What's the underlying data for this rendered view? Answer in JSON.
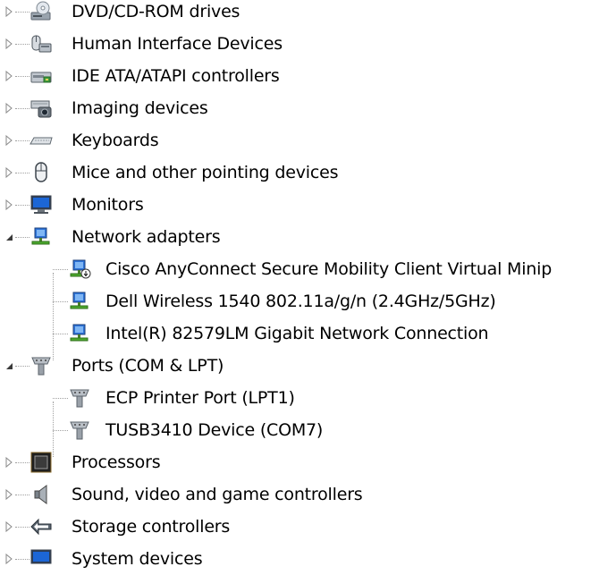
{
  "device_tree": {
    "items": [
      {
        "label": "DVD/CD-ROM drives",
        "icon": "dvd-drive-icon",
        "level": 0,
        "state": "collapsed"
      },
      {
        "label": "Human Interface Devices",
        "icon": "hid-icon",
        "level": 0,
        "state": "collapsed"
      },
      {
        "label": "IDE ATA/ATAPI controllers",
        "icon": "ide-controller-icon",
        "level": 0,
        "state": "collapsed"
      },
      {
        "label": "Imaging devices",
        "icon": "camera-scanner-icon",
        "level": 0,
        "state": "collapsed"
      },
      {
        "label": "Keyboards",
        "icon": "keyboard-icon",
        "level": 0,
        "state": "collapsed"
      },
      {
        "label": "Mice and other pointing devices",
        "icon": "mouse-icon",
        "level": 0,
        "state": "collapsed"
      },
      {
        "label": "Monitors",
        "icon": "monitor-icon",
        "level": 0,
        "state": "collapsed"
      },
      {
        "label": "Network adapters",
        "icon": "network-adapter-icon",
        "level": 0,
        "state": "expanded"
      },
      {
        "label": "Cisco AnyConnect Secure Mobility Client Virtual Minip",
        "icon": "network-adapter-download-icon",
        "level": 1
      },
      {
        "label": "Dell Wireless 1540 802.11a/g/n (2.4GHz/5GHz)",
        "icon": "network-adapter-icon",
        "level": 1
      },
      {
        "label": "Intel(R) 82579LM Gigabit Network Connection",
        "icon": "network-adapter-icon",
        "level": 1
      },
      {
        "label": "Ports (COM & LPT)",
        "icon": "port-connector-icon",
        "level": 0,
        "state": "expanded"
      },
      {
        "label": "ECP Printer Port (LPT1)",
        "icon": "port-connector-icon",
        "level": 1
      },
      {
        "label": "TUSB3410 Device (COM7)",
        "icon": "port-connector-icon",
        "level": 1
      },
      {
        "label": "Processors",
        "icon": "processor-icon",
        "level": 0,
        "state": "collapsed"
      },
      {
        "label": "Sound, video and game controllers",
        "icon": "speaker-icon",
        "level": 0,
        "state": "collapsed"
      },
      {
        "label": "Storage controllers",
        "icon": "storage-controller-icon",
        "level": 0,
        "state": "collapsed"
      },
      {
        "label": "System devices",
        "icon": "system-device-icon",
        "level": 0,
        "state": "collapsed"
      }
    ]
  }
}
